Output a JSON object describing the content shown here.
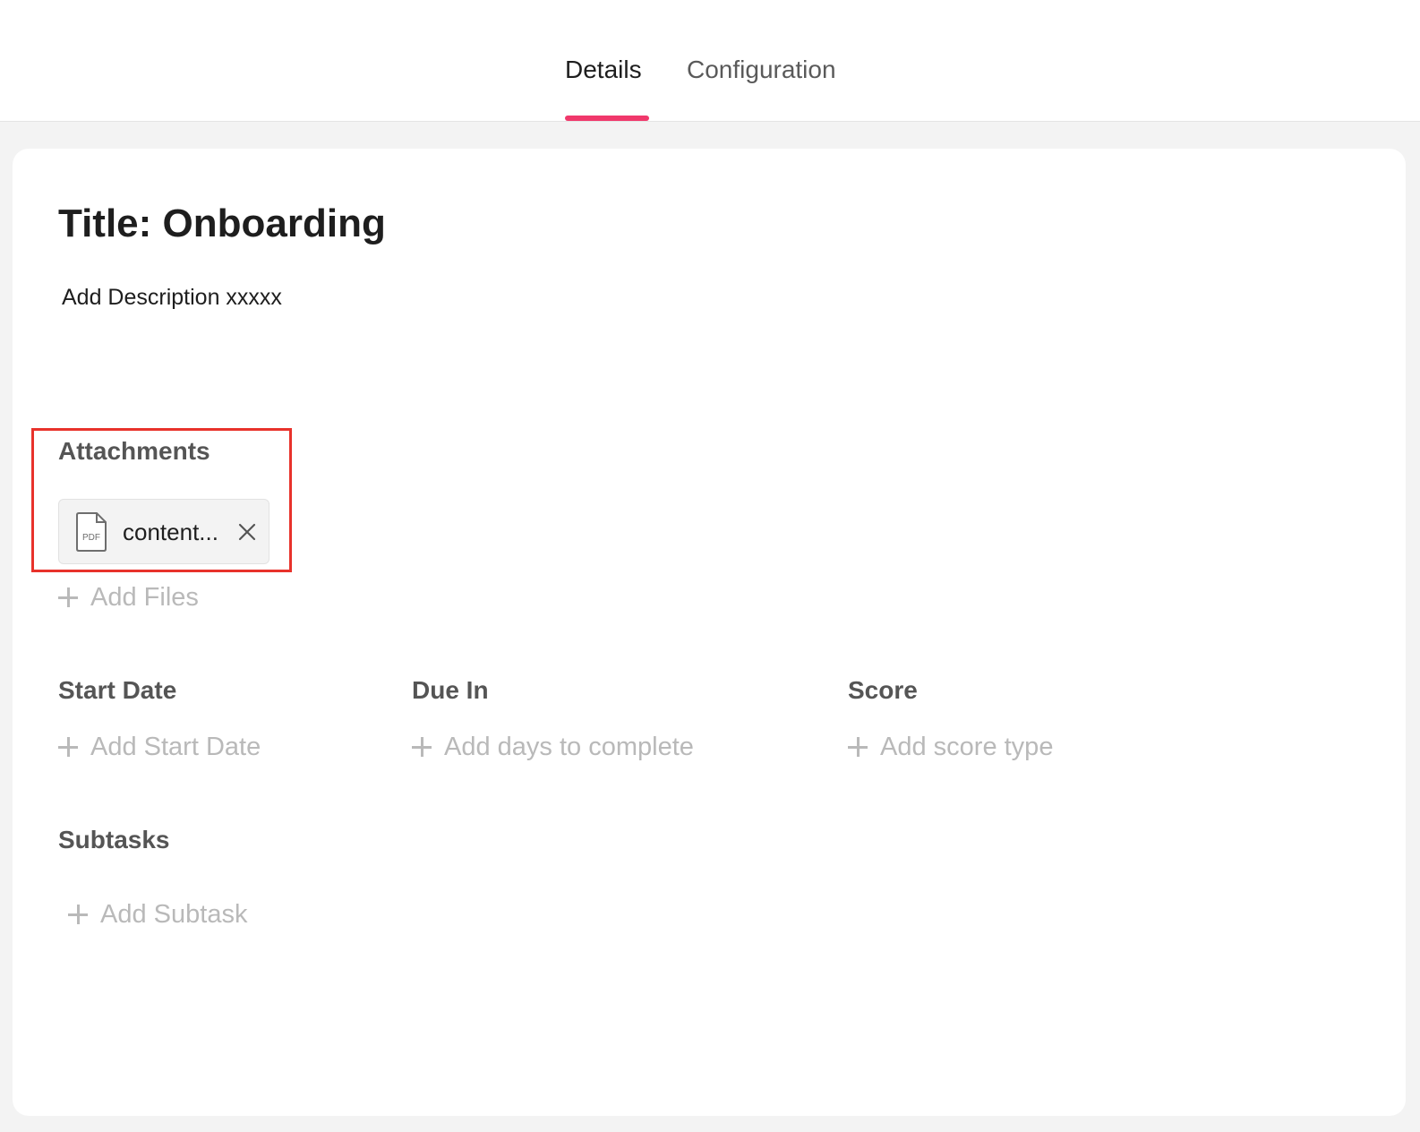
{
  "tabs": {
    "details": "Details",
    "configuration": "Configuration",
    "accent_color": "#f0386b"
  },
  "task": {
    "title": "Title: Onboarding",
    "description": "Add Description xxxxx"
  },
  "attachments": {
    "label": "Attachments",
    "files": [
      {
        "name": "content...",
        "type_badge": "PDF",
        "icon": "pdf-file-icon"
      }
    ],
    "add_label": "Add Files"
  },
  "fields": {
    "start_date": {
      "label": "Start Date",
      "add_label": "Add Start Date"
    },
    "due_in": {
      "label": "Due In",
      "add_label": "Add days to complete"
    },
    "score": {
      "label": "Score",
      "add_label": "Add score type"
    }
  },
  "subtasks": {
    "label": "Subtasks",
    "add_label": "Add Subtask"
  },
  "highlight_color": "#e8322b"
}
